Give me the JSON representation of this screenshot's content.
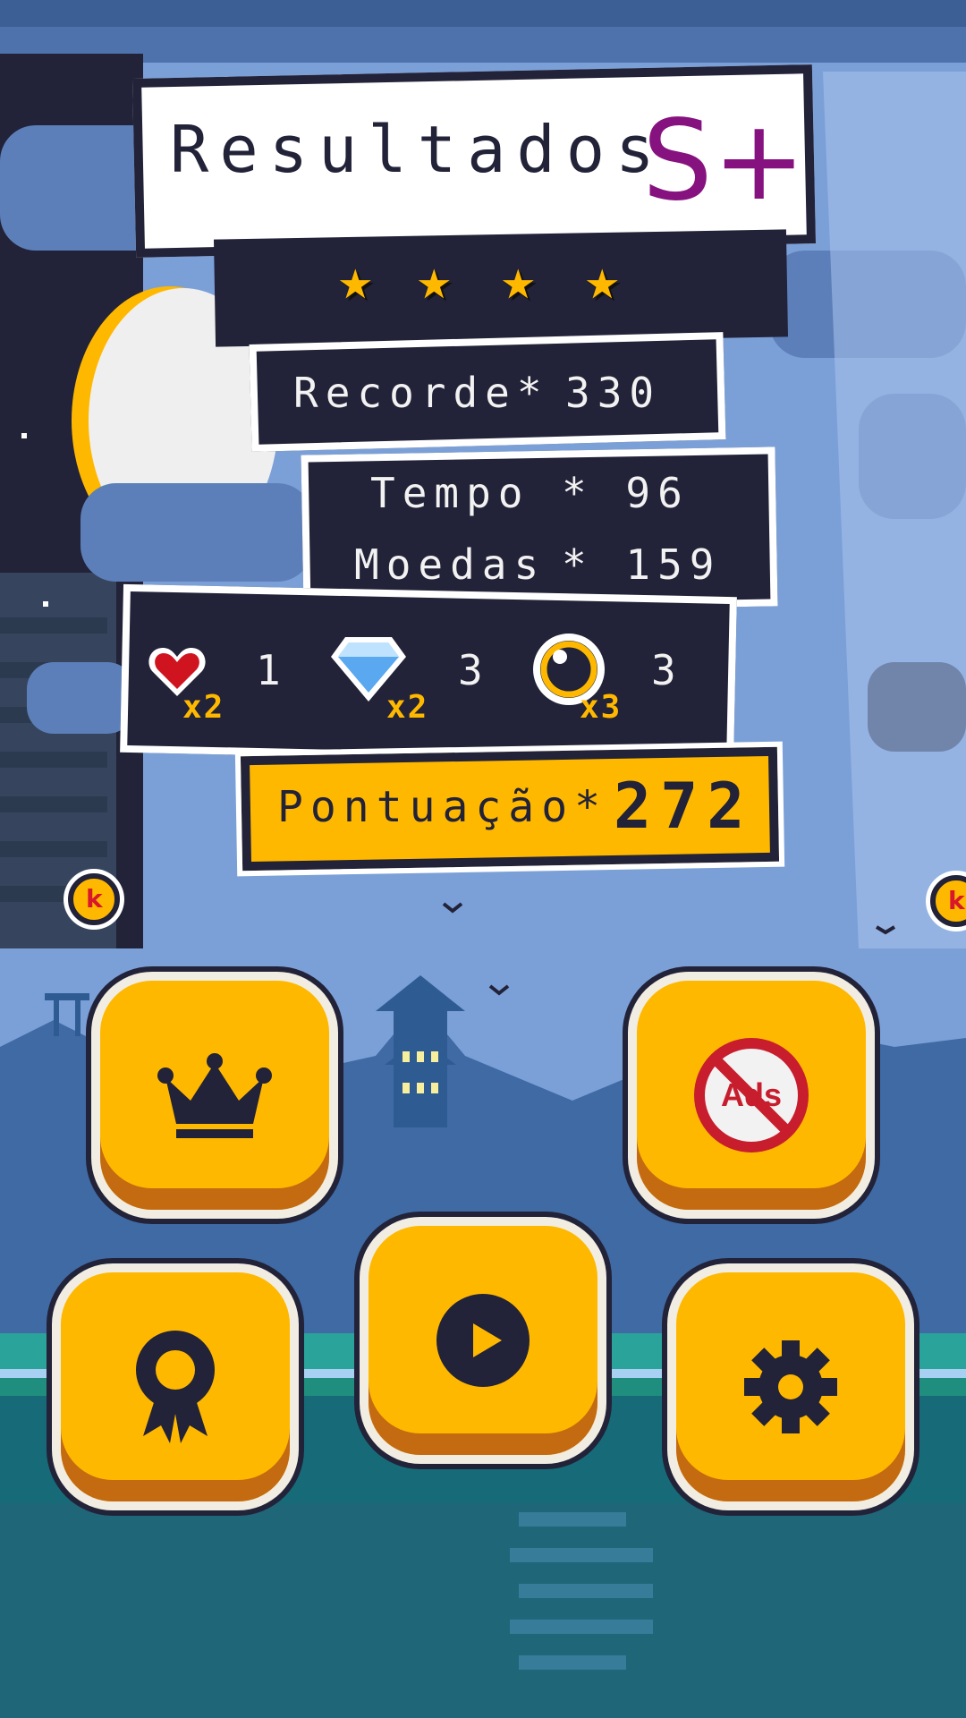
{
  "results": {
    "title": "Resultados",
    "grade": "S+",
    "stars": [
      "★",
      "★",
      "★",
      "★"
    ],
    "record_label": "Recorde*",
    "record_value": "330",
    "time_label": "Tempo",
    "time_value": "* 96",
    "coins_label": "Moedas",
    "coins_value": "* 159",
    "items": [
      {
        "icon": "heart-icon",
        "multiplier": "x2",
        "count": "1"
      },
      {
        "icon": "diamond-icon",
        "multiplier": "x2",
        "count": "3"
      },
      {
        "icon": "ring-icon",
        "multiplier": "x3",
        "count": "3"
      }
    ],
    "score_label": "Pontuação*",
    "score_value": "272"
  },
  "buttons": {
    "leaderboard": "crown-icon",
    "no_ads": "Ads",
    "achievements": "ribbon-icon",
    "play": "play-icon",
    "settings": "gear-icon"
  },
  "colors": {
    "accent": "#ffb800",
    "panel": "#222238",
    "grade": "#86127f"
  }
}
